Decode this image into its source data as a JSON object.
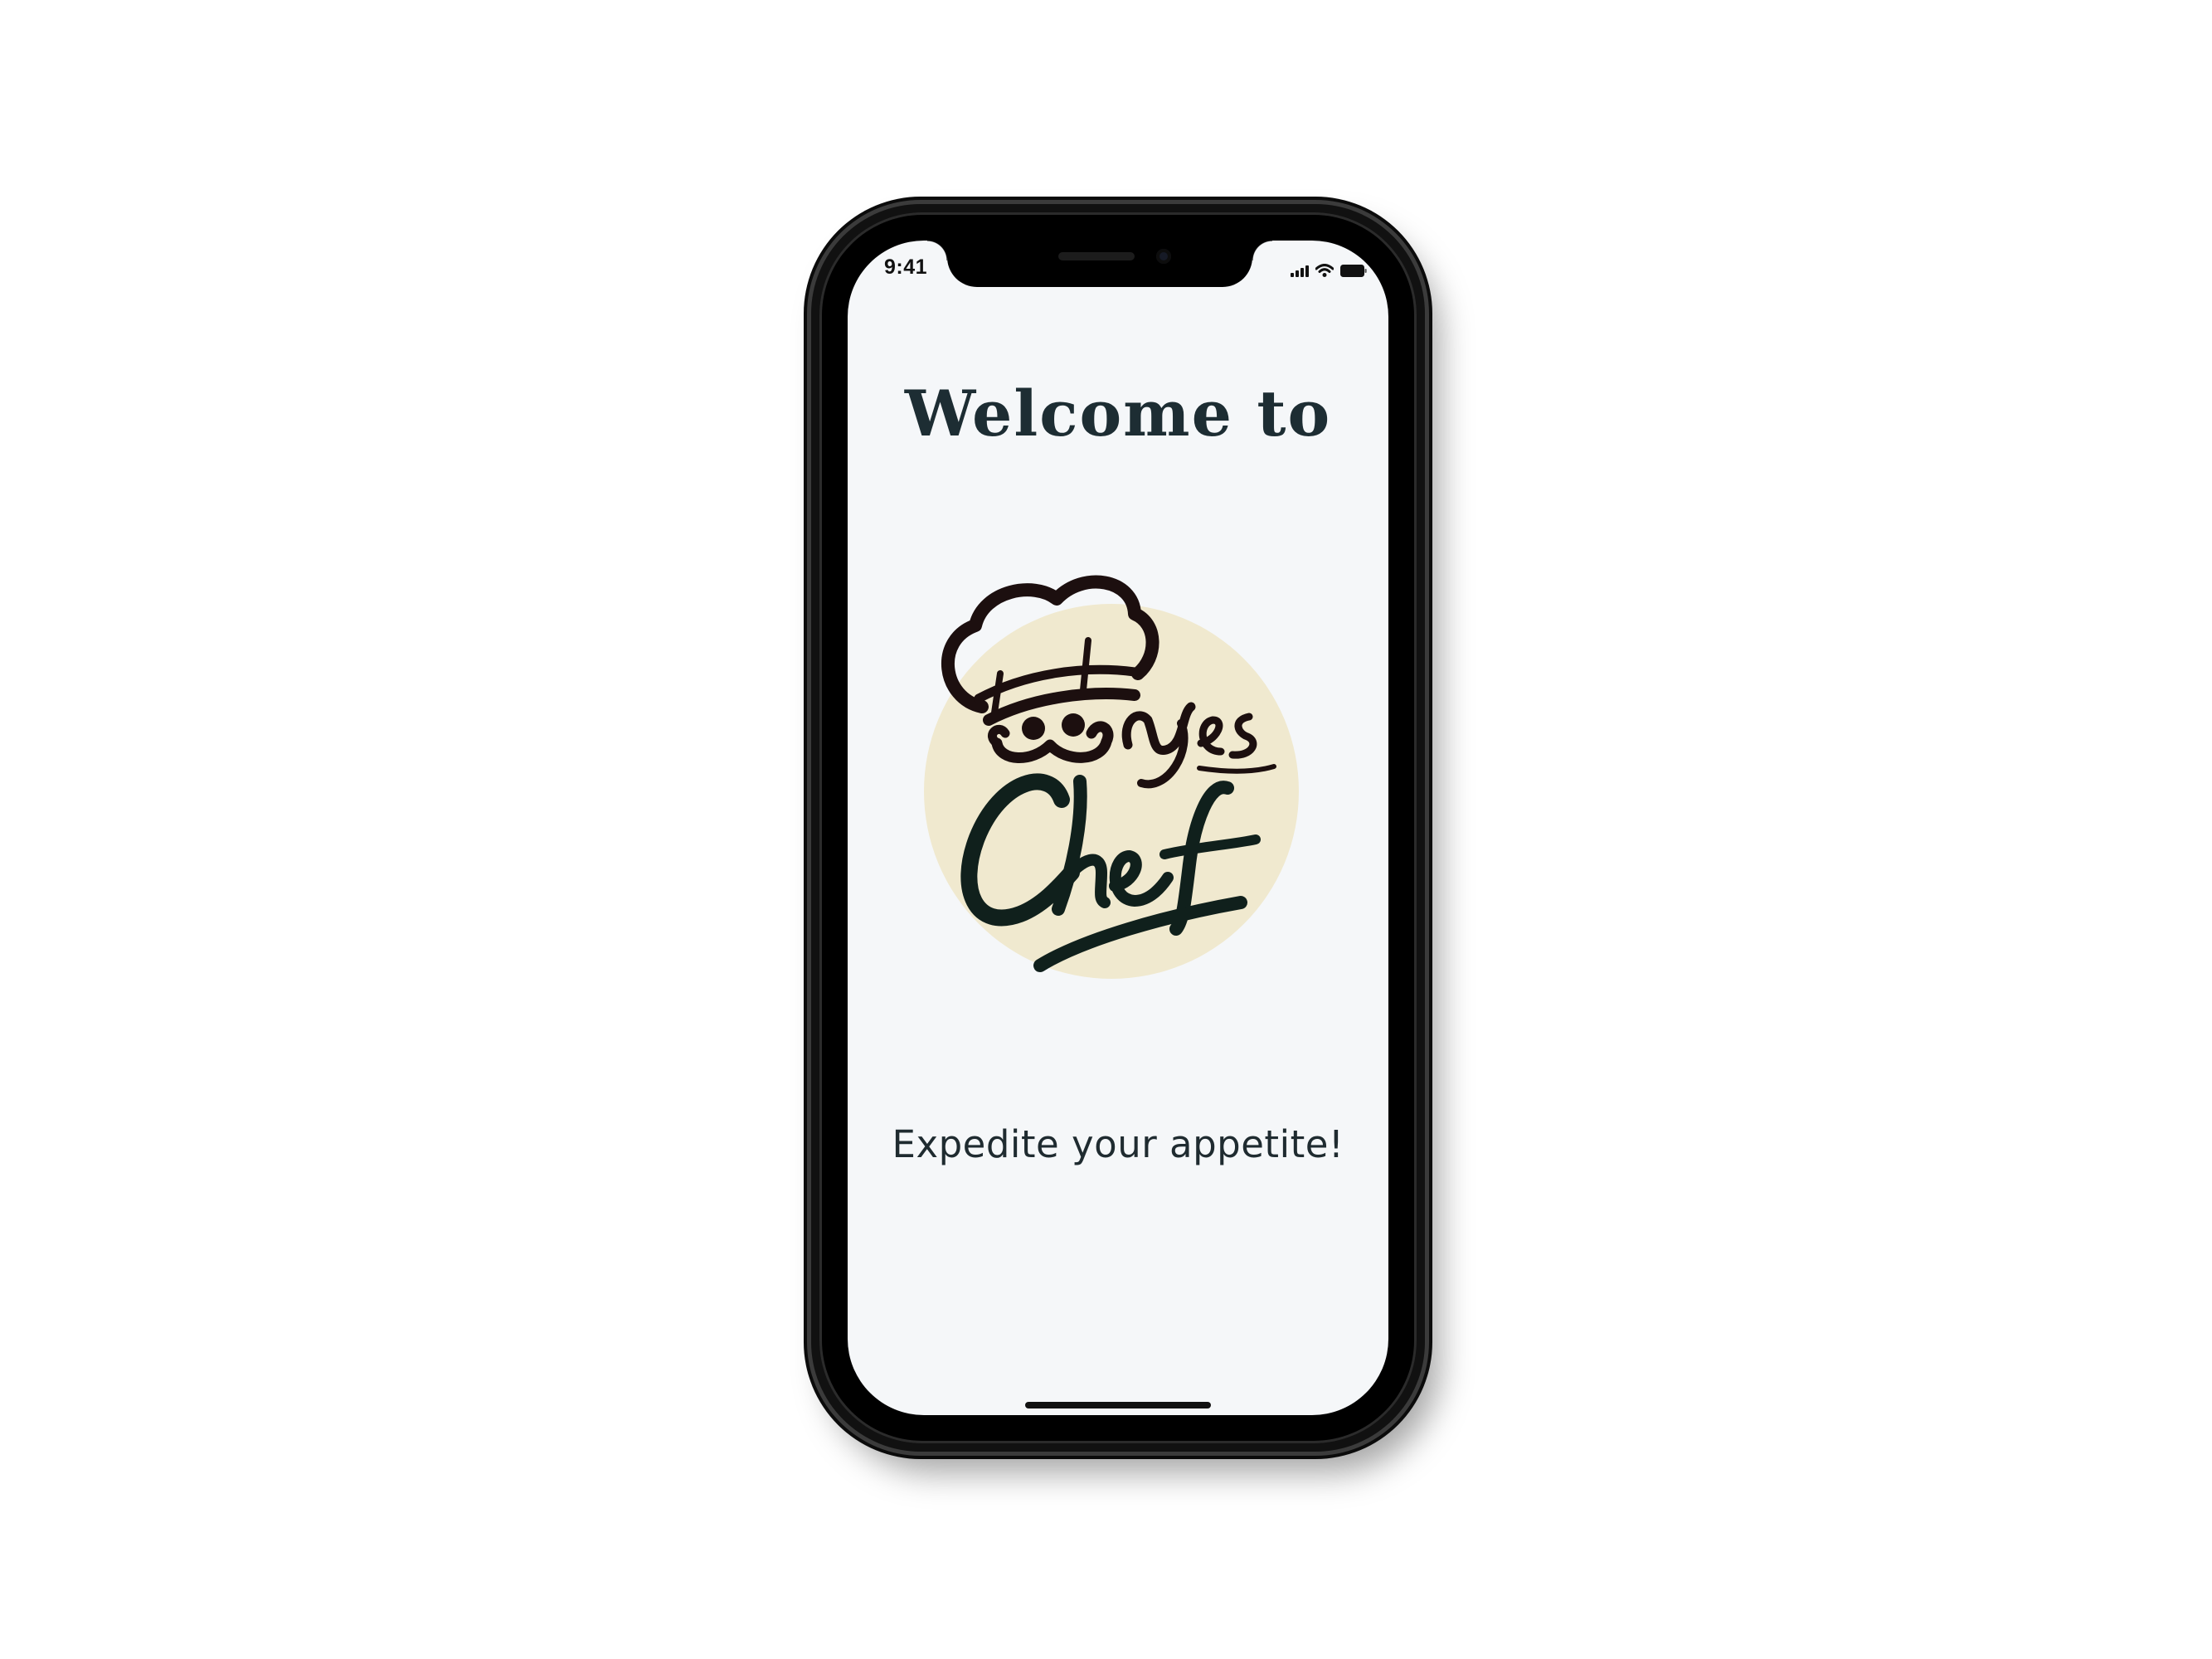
{
  "status_bar": {
    "time": "9:41",
    "icons": [
      "cellular-signal-icon",
      "wifi-icon",
      "battery-icon"
    ]
  },
  "screen": {
    "welcome_text": "Welcome to",
    "logo": {
      "brand_top": "Yes",
      "brand_bottom": "Chef",
      "icon": "chef-hat-mustache-icon"
    },
    "tagline": "Expedite your appetite!"
  },
  "colors": {
    "screen_background": "#f5f7f9",
    "heading": "#1d2d33",
    "logo_circle": "#f0e9cf",
    "logo_ink": "#10201c",
    "chef_ink": "#1c0f0f",
    "device_frame": "#111111"
  }
}
